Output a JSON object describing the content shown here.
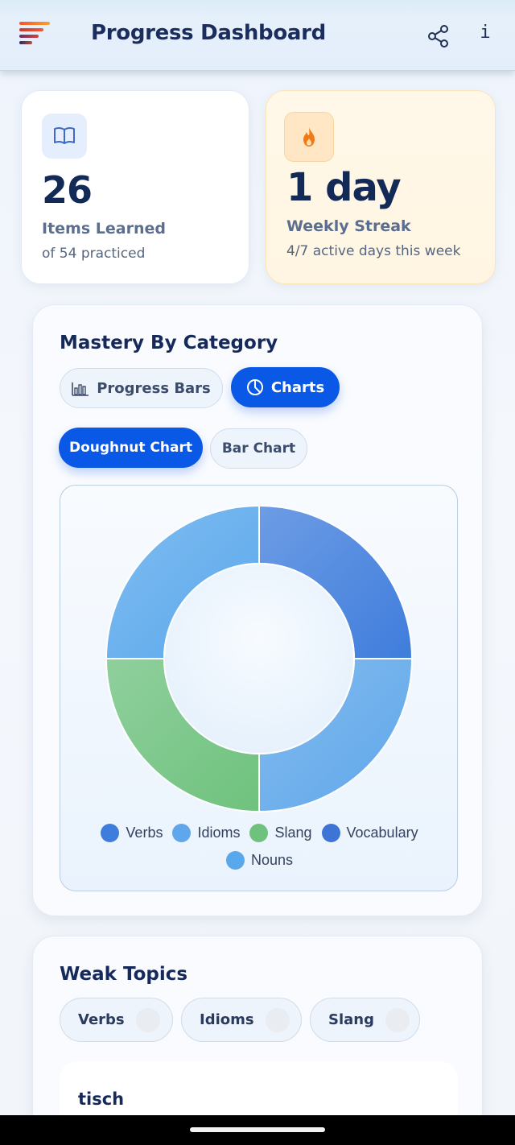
{
  "header": {
    "title": "Progress Dashboard",
    "menu_icon": "menu-icon",
    "share_icon": "share-icon",
    "info_label": "i"
  },
  "stats": {
    "learned": {
      "icon": "book-icon",
      "value": "26",
      "label": "Items Learned",
      "sub": "of 54 practiced"
    },
    "streak": {
      "icon": "flame-icon",
      "value": "1 day",
      "label": "Weekly Streak",
      "sub": "4/7 active days this week"
    }
  },
  "mastery": {
    "title": "Mastery By Category",
    "view_toggle": [
      {
        "label": "Progress Bars",
        "icon": "bar-chart-icon",
        "active": false
      },
      {
        "label": "Charts",
        "icon": "pie-chart-icon",
        "active": true
      }
    ],
    "chart_toggle": [
      {
        "label": "Doughnut Chart",
        "active": true
      },
      {
        "label": "Bar Chart",
        "active": false
      }
    ]
  },
  "chart_data": {
    "type": "pie",
    "variant": "doughnut",
    "categories": [
      "Verbs",
      "Idioms",
      "Slang",
      "Vocabulary",
      "Nouns"
    ],
    "values": [
      25,
      25,
      25,
      0,
      25
    ],
    "colors": [
      "#3f7ddc",
      "#5fa7ea",
      "#6fc27d",
      "#3d74d6",
      "#5aa8ec"
    ],
    "legend_position": "bottom"
  },
  "weak_topics": {
    "title": "Weak Topics",
    "items": [
      "Verbs",
      "Idioms",
      "Slang"
    ],
    "word": "tisch"
  },
  "colors": {
    "accent": "#0a58e6",
    "title": "#15295a",
    "streak_bg": "#fff6e5",
    "flame": "#f07a16"
  }
}
